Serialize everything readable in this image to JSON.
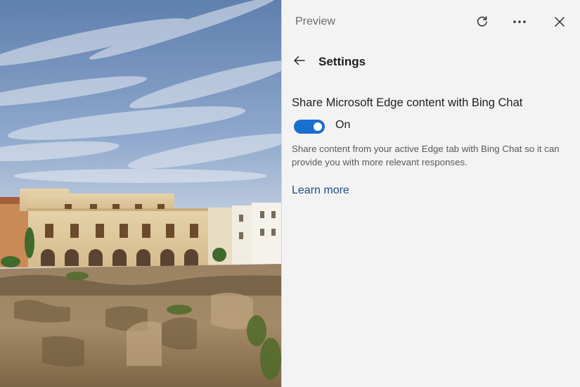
{
  "panel": {
    "title": "Preview",
    "toolbar": {
      "refresh_icon": "refresh-icon",
      "more_icon": "more-options-icon",
      "close_icon": "close-icon"
    },
    "settings_header": {
      "back_icon": "back-arrow-icon",
      "title": "Settings"
    },
    "setting": {
      "heading": "Share Microsoft Edge content with Bing Chat",
      "toggle_state": "On",
      "toggle_on": true,
      "description": "Share content from your active Edge tab with Bing Chat so it can provide you with more relevant responses.",
      "learn_more": "Learn more"
    }
  },
  "colors": {
    "accent": "#1a6fcf",
    "link": "#1a4f8a",
    "panel_bg": "#f3f3f3"
  }
}
